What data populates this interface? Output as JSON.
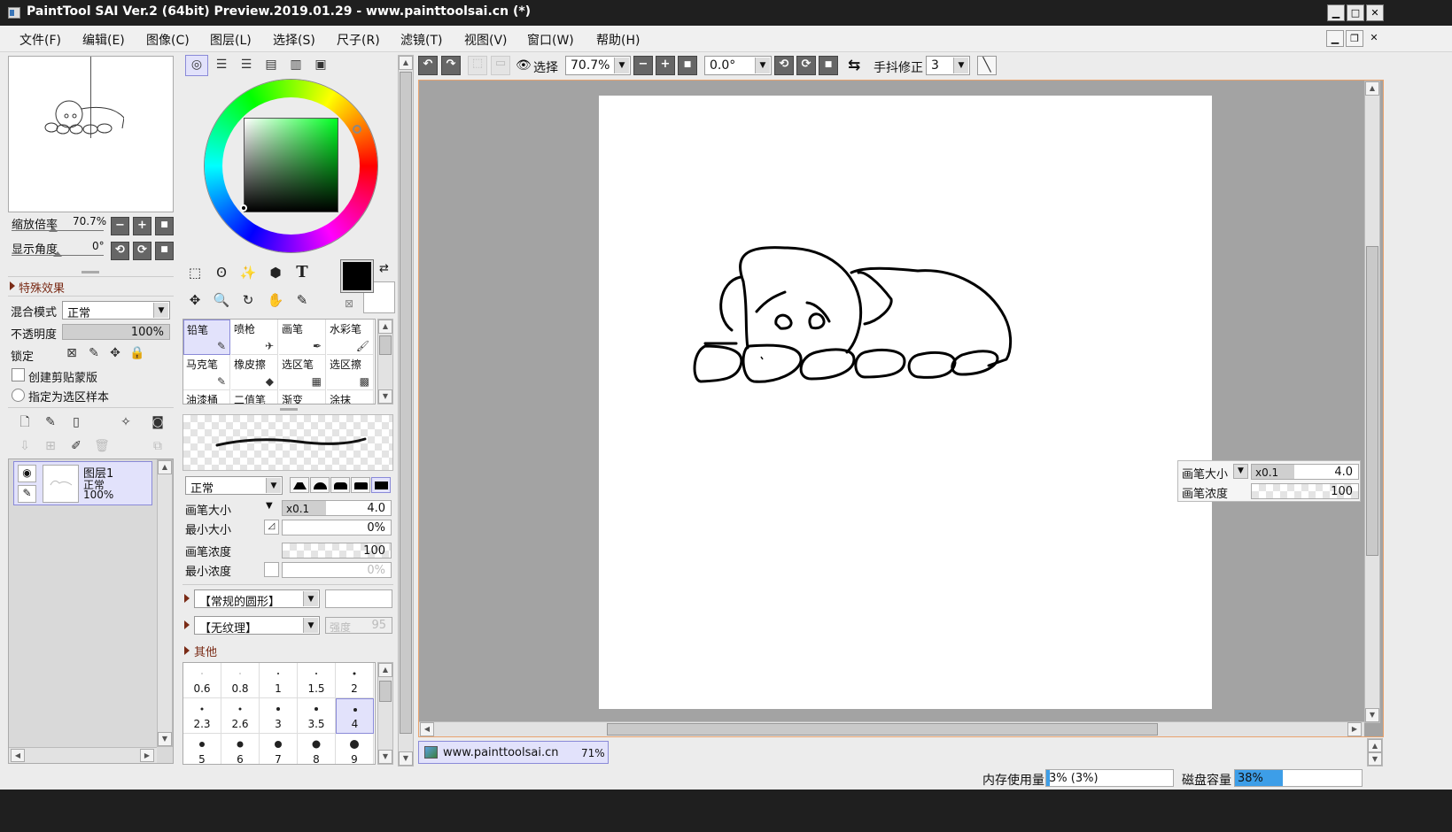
{
  "window": {
    "title": "PaintTool SAI Ver.2 (64bit) Preview.2019.01.29 - www.painttoolsai.cn (*)",
    "min": "▁",
    "max": "□",
    "close": "✕"
  },
  "menu": [
    "文件(F)",
    "编辑(E)",
    "图像(C)",
    "图层(L)",
    "选择(S)",
    "尺子(R)",
    "滤镜(T)",
    "视图(V)",
    "窗口(W)",
    "帮助(H)"
  ],
  "mdi": {
    "min": "▁",
    "restore": "❐",
    "close": "✕"
  },
  "navigator": {
    "zoom_label": "缩放倍率",
    "zoom_value": "70.7%",
    "angle_label": "显示角度",
    "angle_value": "0°"
  },
  "layer_props": {
    "section": "特殊效果",
    "blend_label": "混合模式",
    "blend_value": "正常",
    "opacity_label": "不透明度",
    "opacity_value": "100%",
    "opacity": 1.0,
    "lock_label": "锁定",
    "clip_label": "创建剪贴蒙版",
    "sample_label": "指定为选区样本"
  },
  "layers": [
    {
      "name": "图层1",
      "mode": "正常",
      "opacity": "100%"
    }
  ],
  "tools": {
    "brushes": [
      {
        "name": "铅笔",
        "icon": "✎"
      },
      {
        "name": "喷枪",
        "icon": "✈"
      },
      {
        "name": "画笔",
        "icon": "✒"
      },
      {
        "name": "水彩笔",
        "icon": "🖌"
      },
      {
        "name": "马克笔",
        "icon": "✎"
      },
      {
        "name": "橡皮擦",
        "icon": "◆"
      },
      {
        "name": "选区笔",
        "icon": "▦"
      },
      {
        "name": "选区擦",
        "icon": "▩"
      },
      {
        "name": "油漆桶",
        "icon": ""
      },
      {
        "name": "二值笔",
        "icon": ""
      },
      {
        "name": "渐变",
        "icon": ""
      },
      {
        "name": "涂抹",
        "icon": ""
      }
    ],
    "text_tool": "T"
  },
  "brush_settings": {
    "mode": "正常",
    "size_label": "画笔大小",
    "size_mult": "x0.1",
    "size_value": "4.0",
    "min_size_label": "最小大小",
    "min_size_value": "0%",
    "density_label": "画笔浓度",
    "density_value": "100",
    "min_density_label": "最小浓度",
    "min_density_value": "0%",
    "shape": "【常规的圆形】",
    "texture": "【无纹理】",
    "strength_label": "强度",
    "strength_value": "95",
    "other": "其他"
  },
  "sizes": [
    "0.6",
    "0.8",
    "1",
    "1.5",
    "2",
    "2.3",
    "2.6",
    "3",
    "3.5",
    "4",
    "5",
    "6",
    "7",
    "8",
    "9"
  ],
  "toolbar": {
    "select_label": "选择",
    "zoom": "70.7%",
    "rotation": "0.0°",
    "stab_label": "手抖修正",
    "stab_value": "3"
  },
  "overlay": {
    "size_label": "画笔大小",
    "size_mult": "x0.1",
    "size_value": "4.0",
    "density_label": "画笔浓度",
    "density_value": "100"
  },
  "doc_tab": {
    "name": "www.painttoolsai.cn",
    "zoom": "71%"
  },
  "status": {
    "mem_label": "内存使用量",
    "mem_value": "3% (3%)",
    "mem": 0.03,
    "disk_label": "磁盘容量",
    "disk_value": "38%",
    "disk": 0.38
  },
  "colors": {
    "accent": "#3d9ee8",
    "selection": "#e2e2fb",
    "sel_border": "#8a8ad8"
  }
}
